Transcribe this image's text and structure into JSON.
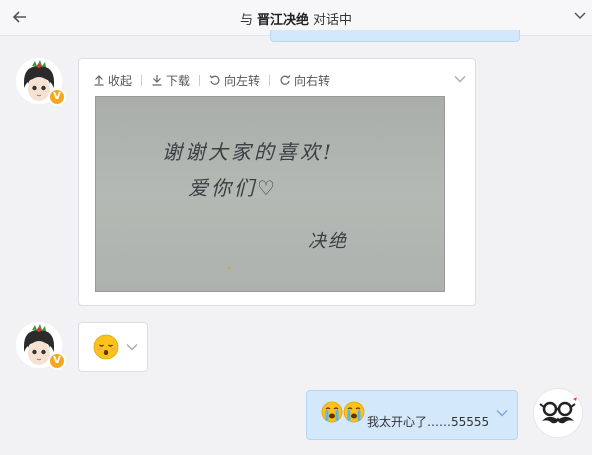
{
  "header": {
    "prefix": "与",
    "contact_name": "晋江决绝",
    "suffix": "对话中"
  },
  "image_card": {
    "toolbar": {
      "collapse_label": "收起",
      "download_label": "下载",
      "rotate_left_label": "向左转",
      "rotate_right_label": "向右转"
    },
    "handwriting": {
      "line1": "谢谢大家的喜欢!",
      "line2": "爱你们♡",
      "signature": "决绝"
    }
  },
  "my_message": {
    "text": "我太开心了……55555"
  },
  "colors": {
    "my_bubble": "#d4e8fc",
    "vip_badge": "#f5a623",
    "background": "#f2f2f5"
  },
  "icons": {
    "back": "arrow-left-icon",
    "expand": "chevron-down-icon",
    "emoji_relieved": "relieved-face-icon",
    "emoji_crying": "loudly-crying-face-icon"
  }
}
